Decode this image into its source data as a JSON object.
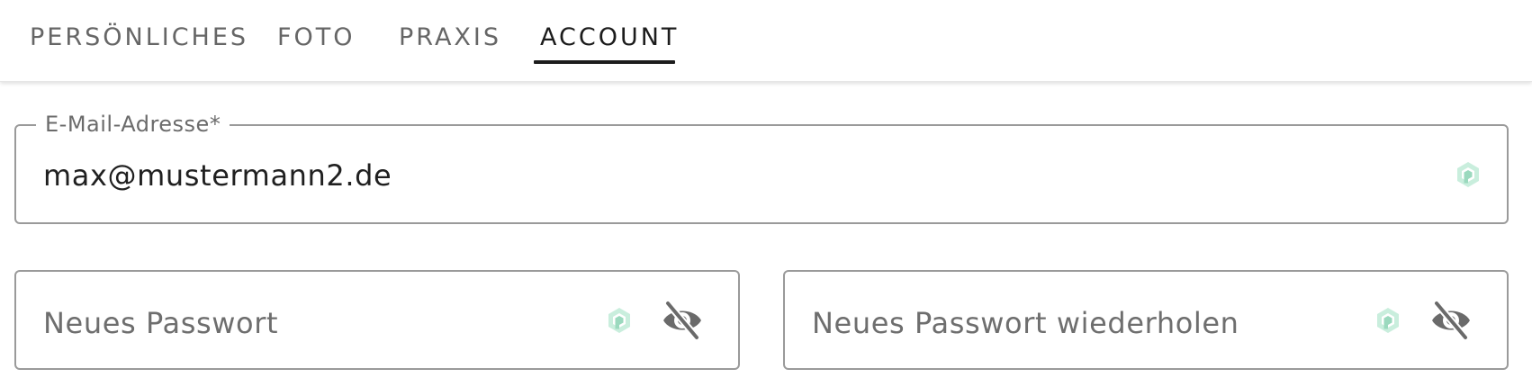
{
  "tabs": [
    {
      "label": "PERSÖNLICHES",
      "active": false
    },
    {
      "label": "FOTO",
      "active": false
    },
    {
      "label": "PRAXIS",
      "active": false
    },
    {
      "label": "ACCOUNT",
      "active": true
    }
  ],
  "email_field": {
    "label": "E-Mail-Adresse*",
    "value": "max@mustermann2.de",
    "icon": "password-manager-icon"
  },
  "new_password_field": {
    "placeholder": "Neues Passwort",
    "icons": [
      "password-manager-icon",
      "eye-off-icon"
    ]
  },
  "repeat_password_field": {
    "placeholder": "Neues Passwort wiederholen",
    "icons": [
      "password-manager-icon",
      "eye-off-icon"
    ]
  },
  "colors": {
    "active_tab": "#1c1c1c",
    "inactive_tab": "#666666",
    "field_border": "#9a9a9a",
    "manager_icon": "#a8e0c8",
    "eye_icon": "#6a6a6a"
  }
}
